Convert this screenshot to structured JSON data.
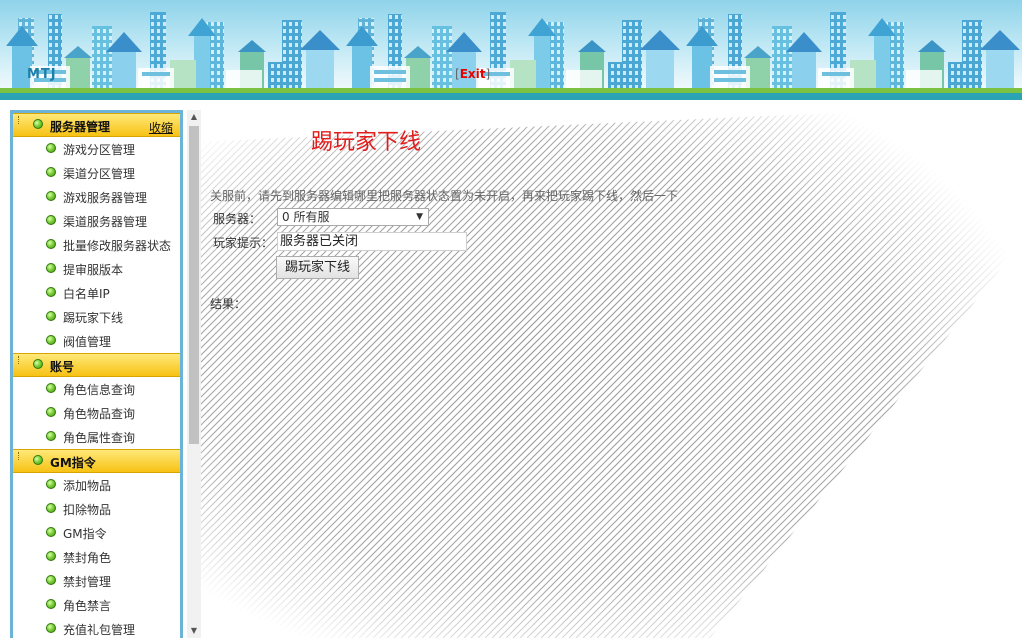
{
  "header": {
    "brand": "MTJ",
    "exit_label": "Exit"
  },
  "sidebar": {
    "sections": [
      {
        "title": "服务器管理",
        "collapse_label": "收缩",
        "items": [
          "游戏分区管理",
          "渠道分区管理",
          "游戏服务器管理",
          "渠道服务器管理",
          "批量修改服务器状态",
          "提审服版本",
          "白名单IP",
          "踢玩家下线",
          "阀值管理"
        ]
      },
      {
        "title": "账号",
        "items": [
          "角色信息查询",
          "角色物品查询",
          "角色属性查询"
        ]
      },
      {
        "title": "GM指令",
        "items": [
          "添加物品",
          "扣除物品",
          "GM指令",
          "禁封角色",
          "禁封管理",
          "角色禁言",
          "充值礼包管理"
        ]
      }
    ]
  },
  "main": {
    "title": "踢玩家下线",
    "notice": "关服前，请先到服务器编辑哪里把服务器状态置为未开启，再来把玩家踢下线，然后一下",
    "server_label": "服务器：",
    "server_value": "0 所有服",
    "tip_label": "玩家提示：",
    "tip_value": "服务器已关闭",
    "kick_button": "踢玩家下线",
    "result_label": "结果："
  },
  "colors": {
    "title_red": "#e21b1b",
    "section_yellow": "#f7c214",
    "sidebar_border": "#6cb3d8",
    "header_green": "#7cc242",
    "header_teal": "#2aa3b4"
  }
}
